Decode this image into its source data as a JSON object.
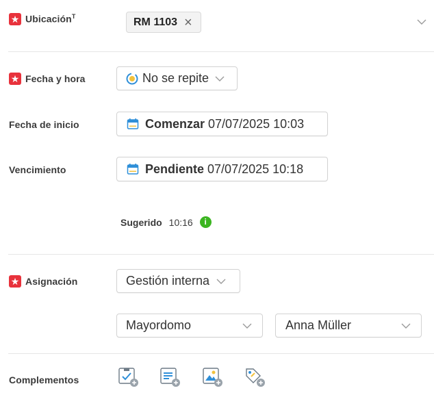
{
  "ubicacion": {
    "label": "Ubicación",
    "sup": "T",
    "chip": "RM 1103",
    "chip_remove": "×"
  },
  "fecha_hora": {
    "label": "Fecha y hora",
    "recurrence": "No se repite"
  },
  "fecha_inicio": {
    "label": "Fecha de inicio",
    "prefix": "Comenzar",
    "value": "07/07/2025 10:03"
  },
  "vencimiento": {
    "label": "Vencimiento",
    "prefix": "Pendiente",
    "value": "07/07/2025 10:18"
  },
  "sugerido": {
    "label": "Sugerido",
    "time": "10:16",
    "info": "i"
  },
  "asignacion": {
    "label": "Asignación",
    "group": "Gestión interna",
    "role": "Mayordomo",
    "person": "Anna Müller"
  },
  "complementos": {
    "label": "Complementos",
    "items": [
      "add-checklist-icon",
      "add-note-icon",
      "add-image-icon",
      "add-tag-icon"
    ]
  },
  "colors": {
    "required": "#e8323c",
    "border": "#d2d2d2",
    "info": "#3cb521",
    "calendar": "#2f8fd8"
  }
}
